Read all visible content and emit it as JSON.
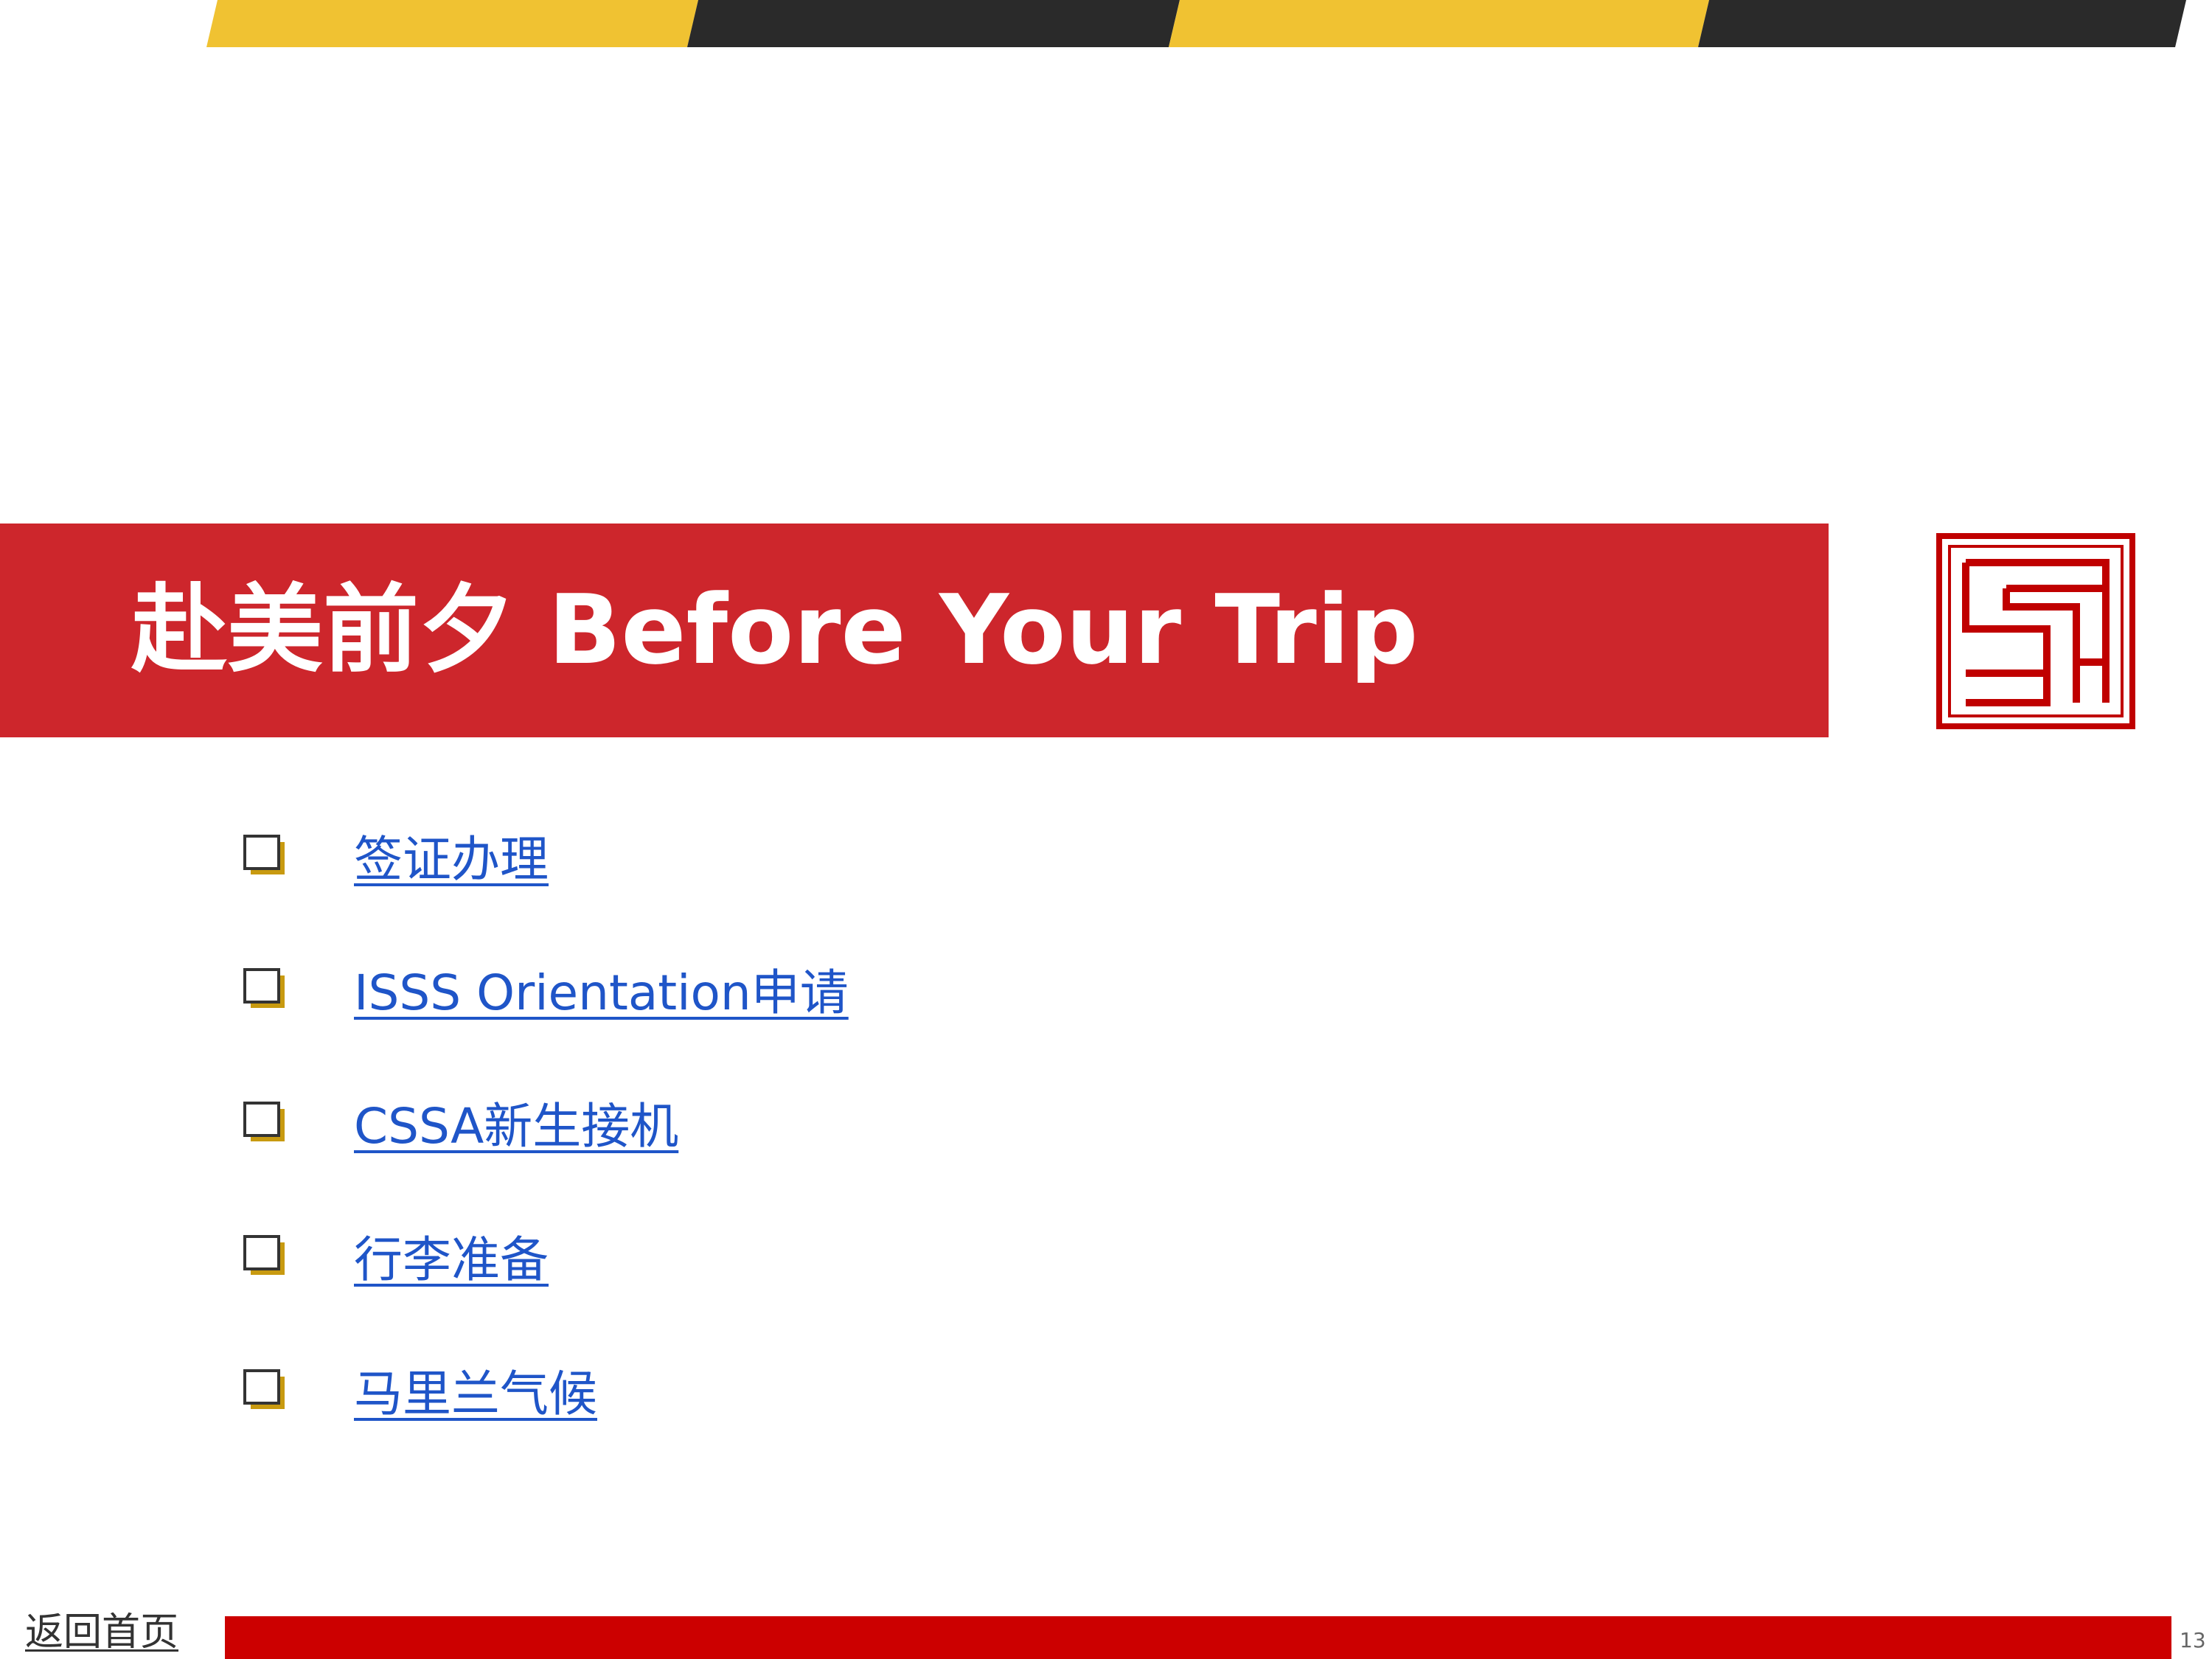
{
  "colors": {
    "stripe_yellow": "#f0c232",
    "stripe_dark": "#2a2a2a",
    "banner_red": "#cd262c",
    "seal_red": "#c00000",
    "link_blue": "#1f55c8",
    "bullet_gold": "#c89a10",
    "footer_red": "#cc0000"
  },
  "slide": {
    "title": "赴美前夕 Before Your Trip",
    "logo_icon": "seal-logo-icon",
    "bullet_icon": "checkbox-bullet-icon",
    "menu_items": [
      {
        "label": "签证办理"
      },
      {
        "label": "ISSS Orientation申请"
      },
      {
        "label": "CSSA新生接机"
      },
      {
        "label": "行李准备"
      },
      {
        "label": "马里兰气候"
      }
    ]
  },
  "footer": {
    "home_link": "返回首页",
    "page_number": "13"
  }
}
